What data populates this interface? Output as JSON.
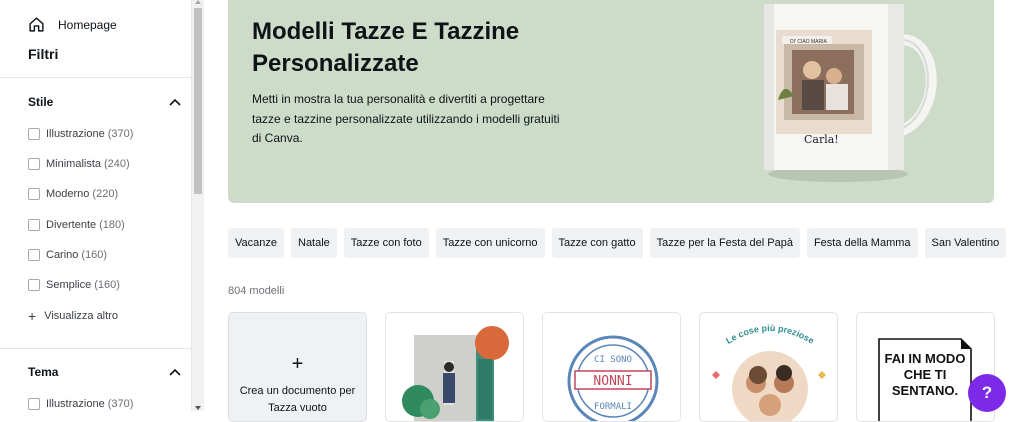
{
  "sidebar": {
    "home_label": "Homepage",
    "filters_title": "Filtri",
    "style_section": {
      "title": "Stile",
      "items": [
        {
          "label": "Illustrazione",
          "count": "(370)"
        },
        {
          "label": "Minimalista",
          "count": "(240)"
        },
        {
          "label": "Moderno",
          "count": "(220)"
        },
        {
          "label": "Divertente",
          "count": "(180)"
        },
        {
          "label": "Carino",
          "count": "(160)"
        },
        {
          "label": "Semplice",
          "count": "(160)"
        }
      ],
      "show_more": "Visualizza altro"
    },
    "theme_section": {
      "title": "Tema",
      "items": [
        {
          "label": "Illustrazione",
          "count": "(370)"
        }
      ]
    }
  },
  "hero": {
    "title": "Modelli Tazze E Tazzine Personalizzate",
    "description": "Metti in mostra la tua personalità e divertiti a progettare tazze e tazzine personalizzate utilizzando i modelli gratuiti di Canva.",
    "mug_caption": "Carla!",
    "mug_tag": "DI' CIAO MARIA",
    "background_color": "#cddbc8"
  },
  "chips": [
    "Vacanze",
    "Natale",
    "Tazze con foto",
    "Tazze con unicorno",
    "Tazze con gatto",
    "Tazze per la Festa del Papà",
    "Festa della Mamma",
    "San Valentino"
  ],
  "results_count": "804 modelli",
  "blank_card": {
    "plus": "+",
    "label": "Crea un documento per Tazza vuoto"
  },
  "cards": [
    {
      "text": ""
    },
    {
      "text_top": "CI SONO",
      "text_mid": "NONNI",
      "text_bot": "FORMALI"
    },
    {
      "text": "Le cose più preziose"
    },
    {
      "text": "FAI IN MODO CHE TI SENTANO."
    }
  ],
  "help_button": "?",
  "colors": {
    "accent": "#7d2ae8",
    "chip_bg": "#eff1f3"
  }
}
